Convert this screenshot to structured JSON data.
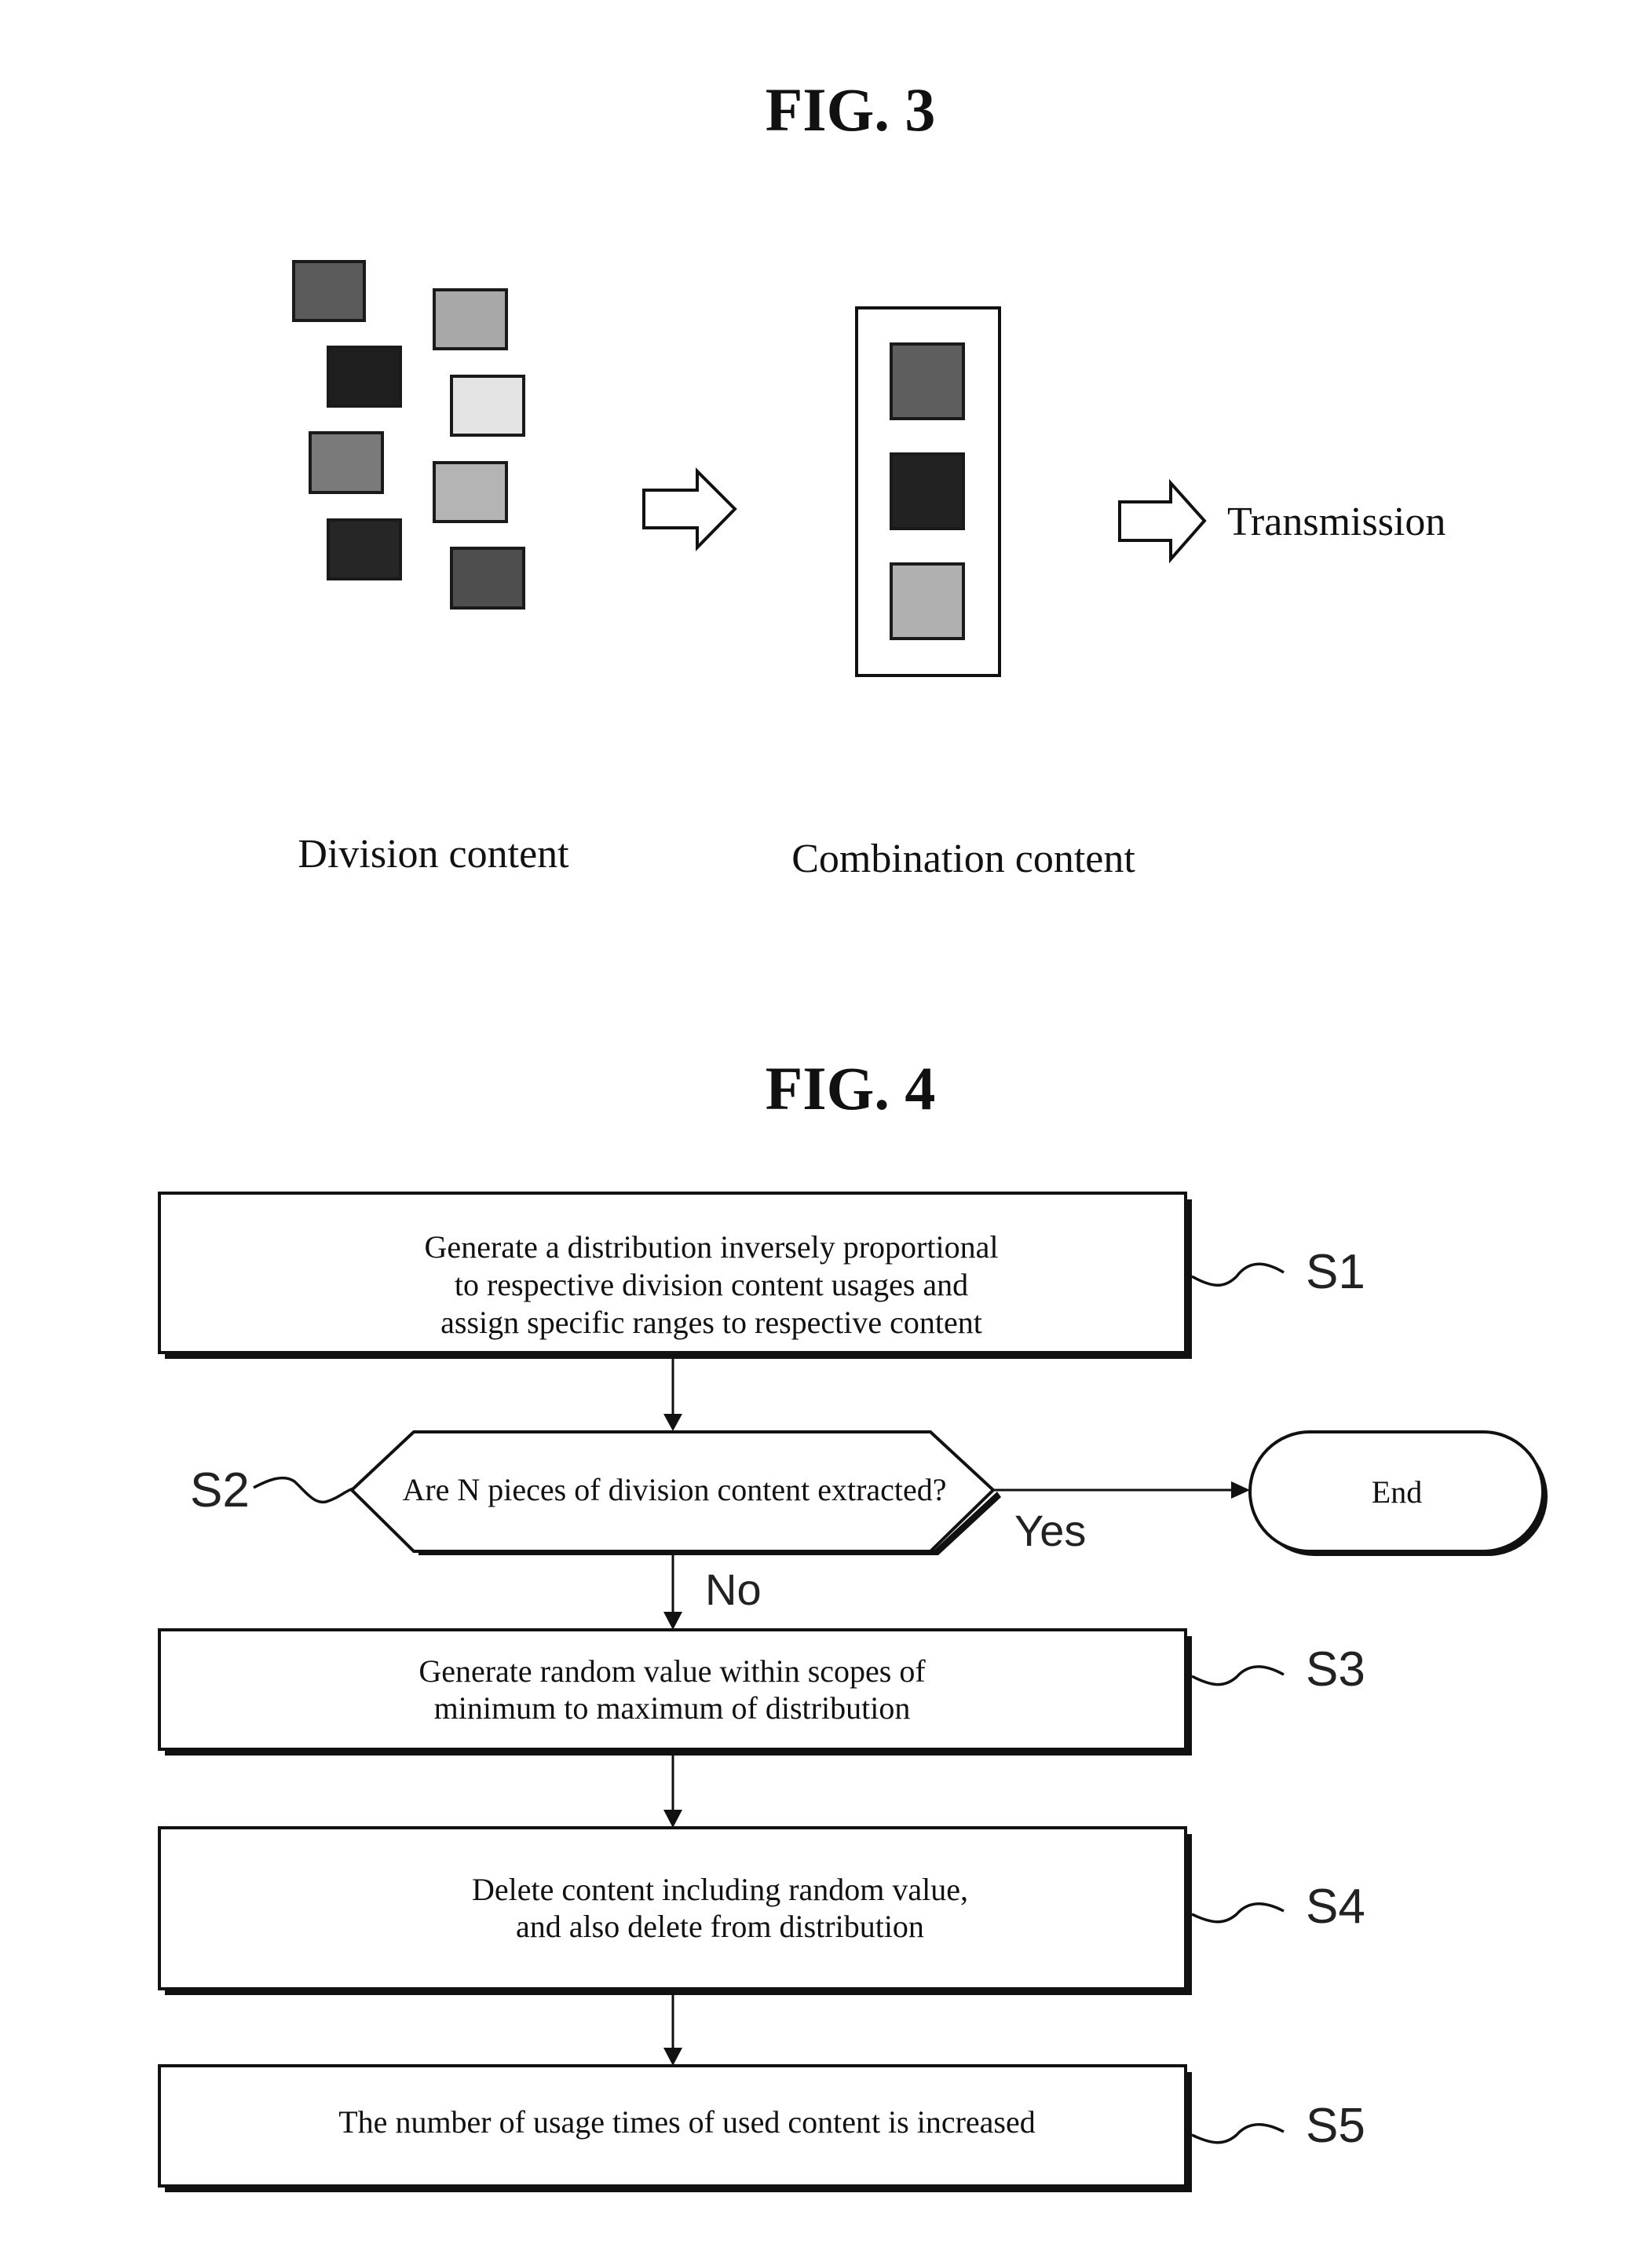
{
  "fig3": {
    "title": "FIG. 3",
    "division_caption": "Division content",
    "combination_caption": "Combination content",
    "transmission_label": "Transmission",
    "division_tiles": [
      {
        "shade": "#5a5a5a"
      },
      {
        "shade": "#a8a8a8"
      },
      {
        "shade": "#1e1e1e"
      },
      {
        "shade": "#e4e4e4"
      },
      {
        "shade": "#7a7a7a"
      },
      {
        "shade": "#b4b4b4"
      },
      {
        "shade": "#262626"
      },
      {
        "shade": "#4e4e4e"
      }
    ],
    "combination_tiles": [
      {
        "shade": "#5e5e5e"
      },
      {
        "shade": "#222222"
      },
      {
        "shade": "#b0b0b0"
      }
    ]
  },
  "fig4": {
    "title": "FIG. 4",
    "steps": [
      {
        "id": "S1",
        "lines": [
          "Generate a distribution inversely proportional",
          "to respective division content usages and",
          "assign specific ranges to respective content"
        ]
      },
      {
        "id": "S2",
        "lines": [
          "Are N pieces of division content extracted?"
        ]
      },
      {
        "id": "S3",
        "lines": [
          "Generate random value within scopes of",
          "minimum to maximum of distribution"
        ]
      },
      {
        "id": "S4",
        "lines": [
          "Delete content including random value,",
          "and also delete from distribution"
        ]
      },
      {
        "id": "S5",
        "lines": [
          "The number of usage times of used content is increased"
        ]
      }
    ],
    "end_label": "End",
    "yes_label": "Yes",
    "no_label": "No"
  }
}
